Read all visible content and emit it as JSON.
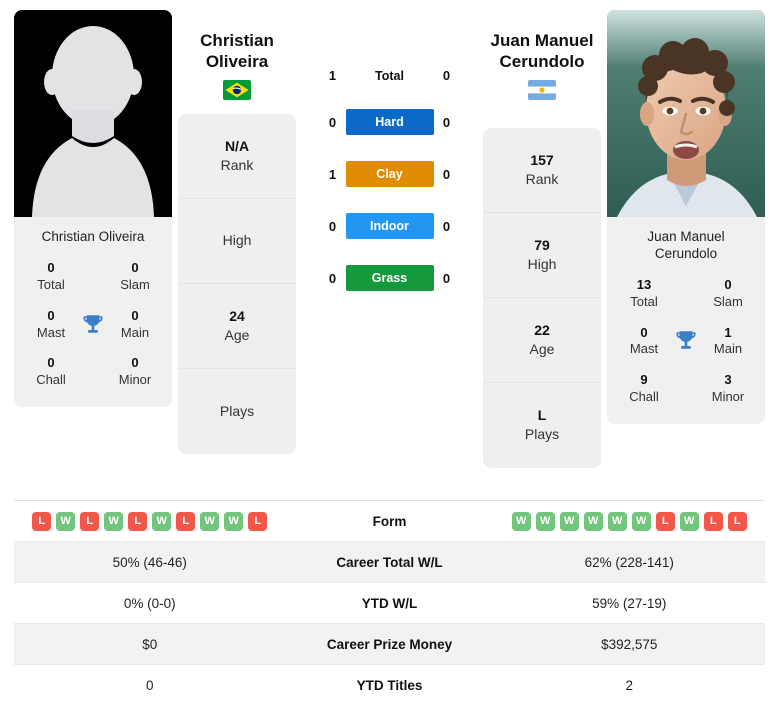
{
  "players": {
    "left": {
      "name": "Christian Oliveira",
      "name_line1": "Christian",
      "name_line2": "Oliveira",
      "country": "Brazil",
      "flag_icon": "flag-brazil",
      "photo_type": "placeholder-silhouette",
      "card_name": "Christian Oliveira",
      "stats": [
        {
          "value": "N/A",
          "label": "Rank"
        },
        {
          "value": "",
          "label": "High"
        },
        {
          "value": "24",
          "label": "Age"
        },
        {
          "value": "",
          "label": "Plays"
        }
      ],
      "titles": [
        {
          "value": "0",
          "label": "Total"
        },
        {
          "value": "0",
          "label": "Slam"
        },
        {
          "value": "0",
          "label": "Mast"
        },
        {
          "value": "0",
          "label": "Main"
        },
        {
          "value": "0",
          "label": "Chall"
        },
        {
          "value": "0",
          "label": "Minor"
        }
      ],
      "form": [
        "L",
        "W",
        "L",
        "W",
        "L",
        "W",
        "L",
        "W",
        "W",
        "L"
      ],
      "career_total_wl": "50% (46-46)",
      "ytd_wl": "0% (0-0)",
      "career_prize_money": "$0",
      "ytd_titles": "0"
    },
    "right": {
      "name": "Juan Manuel Cerundolo",
      "name_line1": "Juan Manuel",
      "name_line2": "Cerundolo",
      "country": "Argentina",
      "flag_icon": "flag-argentina",
      "photo_type": "player-photo",
      "card_name_line1": "Juan Manuel",
      "card_name_line2": "Cerundolo",
      "stats": [
        {
          "value": "157",
          "label": "Rank"
        },
        {
          "value": "79",
          "label": "High"
        },
        {
          "value": "22",
          "label": "Age"
        },
        {
          "value": "L",
          "label": "Plays"
        }
      ],
      "titles": [
        {
          "value": "13",
          "label": "Total"
        },
        {
          "value": "0",
          "label": "Slam"
        },
        {
          "value": "0",
          "label": "Mast"
        },
        {
          "value": "1",
          "label": "Main"
        },
        {
          "value": "9",
          "label": "Chall"
        },
        {
          "value": "3",
          "label": "Minor"
        }
      ],
      "form": [
        "W",
        "W",
        "W",
        "W",
        "W",
        "W",
        "L",
        "W",
        "L",
        "L"
      ],
      "career_total_wl": "62% (228-141)",
      "ytd_wl": "59% (27-19)",
      "career_prize_money": "$392,575",
      "ytd_titles": "2"
    }
  },
  "head_to_head": [
    {
      "label": "Total",
      "left": "1",
      "right": "0",
      "style": "plain",
      "color": ""
    },
    {
      "label": "Hard",
      "left": "0",
      "right": "0",
      "style": "pill",
      "color": "#0b69c7"
    },
    {
      "label": "Clay",
      "left": "1",
      "right": "0",
      "style": "pill",
      "color": "#e08c00"
    },
    {
      "label": "Indoor",
      "left": "0",
      "right": "0",
      "style": "pill",
      "color": "#2196f3"
    },
    {
      "label": "Grass",
      "left": "0",
      "right": "0",
      "style": "pill",
      "color": "#149a3d"
    }
  ],
  "comparison_rows": [
    {
      "label": "Form",
      "type": "form",
      "shaded": false
    },
    {
      "label": "Career Total W/L",
      "type": "text",
      "shaded": true,
      "left": "50% (46-46)",
      "right": "62% (228-141)"
    },
    {
      "label": "YTD W/L",
      "type": "text",
      "shaded": false,
      "left": "0% (0-0)",
      "right": "59% (27-19)"
    },
    {
      "label": "Career Prize Money",
      "type": "text",
      "shaded": true,
      "left": "$0",
      "right": "$392,575"
    },
    {
      "label": "YTD Titles",
      "type": "text",
      "shaded": false,
      "left": "0",
      "right": "2"
    }
  ],
  "colors": {
    "win_badge": "#73c47c",
    "loss_badge": "#f2574a",
    "trophy": "#3b7fc4",
    "card_bg": "#f0f0f0",
    "row_shaded": "#f2f2f2"
  }
}
